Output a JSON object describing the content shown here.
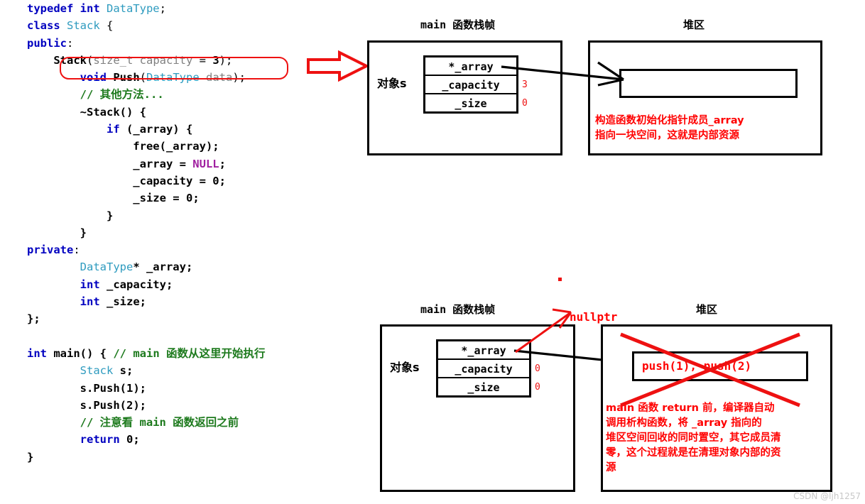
{
  "code": {
    "lines": [
      [
        {
          "t": "typedef ",
          "c": "kw"
        },
        {
          "t": "int ",
          "c": "kw"
        },
        {
          "t": "DataType",
          "c": "ty"
        },
        {
          "t": ";",
          "c": "pl"
        }
      ],
      [
        {
          "t": "class ",
          "c": "kw"
        },
        {
          "t": "Stack",
          "c": "ty"
        },
        {
          "t": " {",
          "c": "pl"
        }
      ],
      [
        {
          "t": "public",
          "c": "kw"
        },
        {
          "t": ":",
          "c": "pl"
        }
      ],
      [
        {
          "t": "    Stack",
          "c": "nm"
        },
        {
          "t": "(",
          "c": "pl"
        },
        {
          "t": "size_t capacity",
          "c": "gr"
        },
        {
          "t": " = ",
          "c": "pl"
        },
        {
          "t": "3",
          "c": "num"
        },
        {
          "t": ");",
          "c": "pl"
        }
      ],
      [
        {
          "t": "        ",
          "c": "pl"
        },
        {
          "t": "void ",
          "c": "kw"
        },
        {
          "t": "Push",
          "c": "nm"
        },
        {
          "t": "(",
          "c": "pl"
        },
        {
          "t": "DataType",
          "c": "ty"
        },
        {
          "t": " data",
          "c": "gr"
        },
        {
          "t": ");",
          "c": "pl"
        }
      ],
      [
        {
          "t": "        ",
          "c": "pl"
        },
        {
          "t": "// 其他方法...",
          "c": "cm"
        }
      ],
      [
        {
          "t": "        ~Stack() {",
          "c": "nm"
        }
      ],
      [
        {
          "t": "            ",
          "c": "pl"
        },
        {
          "t": "if",
          "c": "kw"
        },
        {
          "t": " (_array) {",
          "c": "nm"
        }
      ],
      [
        {
          "t": "                free",
          "c": "nm"
        },
        {
          "t": "(_array);",
          "c": "nm"
        }
      ],
      [
        {
          "t": "                _array = ",
          "c": "nm"
        },
        {
          "t": "NULL",
          "c": "nl"
        },
        {
          "t": ";",
          "c": "nm"
        }
      ],
      [
        {
          "t": "                _capacity = ",
          "c": "nm"
        },
        {
          "t": "0",
          "c": "num"
        },
        {
          "t": ";",
          "c": "nm"
        }
      ],
      [
        {
          "t": "                _size = ",
          "c": "nm"
        },
        {
          "t": "0",
          "c": "num"
        },
        {
          "t": ";",
          "c": "nm"
        }
      ],
      [
        {
          "t": "            }",
          "c": "nm"
        }
      ],
      [
        {
          "t": "        }",
          "c": "nm"
        }
      ],
      [
        {
          "t": "private",
          "c": "kw"
        },
        {
          "t": ":",
          "c": "pl"
        }
      ],
      [
        {
          "t": "        ",
          "c": "pl"
        },
        {
          "t": "DataType",
          "c": "ty"
        },
        {
          "t": "* _array;",
          "c": "nm"
        }
      ],
      [
        {
          "t": "        ",
          "c": "pl"
        },
        {
          "t": "int",
          "c": "kw"
        },
        {
          "t": " _capacity;",
          "c": "nm"
        }
      ],
      [
        {
          "t": "        ",
          "c": "pl"
        },
        {
          "t": "int",
          "c": "kw"
        },
        {
          "t": " _size;",
          "c": "nm"
        }
      ],
      [
        {
          "t": "};",
          "c": "nm"
        }
      ],
      [
        {
          "t": "",
          "c": "pl"
        }
      ],
      [
        {
          "t": "int ",
          "c": "kw"
        },
        {
          "t": "main",
          "c": "nm"
        },
        {
          "t": "() { ",
          "c": "nm"
        },
        {
          "t": "// main 函数从这里开始执行",
          "c": "cm"
        }
      ],
      [
        {
          "t": "        ",
          "c": "pl"
        },
        {
          "t": "Stack",
          "c": "ty"
        },
        {
          "t": " s;",
          "c": "nm"
        }
      ],
      [
        {
          "t": "        s.",
          "c": "nm"
        },
        {
          "t": "Push",
          "c": "nm"
        },
        {
          "t": "(1);",
          "c": "nm"
        }
      ],
      [
        {
          "t": "        s.",
          "c": "nm"
        },
        {
          "t": "Push",
          "c": "nm"
        },
        {
          "t": "(2);",
          "c": "nm"
        }
      ],
      [
        {
          "t": "        ",
          "c": "pl"
        },
        {
          "t": "// 注意看 main 函数返回之前",
          "c": "cm"
        }
      ],
      [
        {
          "t": "        ",
          "c": "pl"
        },
        {
          "t": "return ",
          "c": "kw"
        },
        {
          "t": "0",
          "c": "num"
        },
        {
          "t": ";",
          "c": "nm"
        }
      ],
      [
        {
          "t": "}",
          "c": "nm"
        }
      ]
    ],
    "highlighted_line": "Stack(size_t capacity = 3);"
  },
  "diagram_top": {
    "stack_title": "main 函数栈帧",
    "heap_title": "堆区",
    "object_label": "对象s",
    "fields": [
      {
        "name": "*_array",
        "value": ""
      },
      {
        "name": "_capacity",
        "value": "3"
      },
      {
        "name": "_size",
        "value": "0"
      }
    ],
    "heap_note": "构造函数初始化指针成员_array\n指向一块空间，这就是内部资源"
  },
  "diagram_bottom": {
    "stack_title": "main 函数栈帧",
    "heap_title": "堆区",
    "object_label": "对象s",
    "nullptr_label": "nullptr",
    "fields": [
      {
        "name": "*_array",
        "value": ""
      },
      {
        "name": "_capacity",
        "value": "0"
      },
      {
        "name": "_size",
        "value": "0"
      }
    ],
    "heap_slot_text": "push(1),  push(2)",
    "heap_note": "main 函数 return 前，编译器自动\n调用析构函数，将 _array 指向的\n堆区空间回收的同时置空，其它成员清\n零，这个过程就是在清理对象内部的资\n源"
  },
  "watermark": "CSDN @ljh1257",
  "colors": {
    "highlight_red": "#ee1111",
    "note_red": "#ff0000",
    "keyword_blue": "#0000c0",
    "type_cyan": "#2e9bbf",
    "comment_green": "#1d7a1d",
    "null_purple": "#a020a0"
  }
}
